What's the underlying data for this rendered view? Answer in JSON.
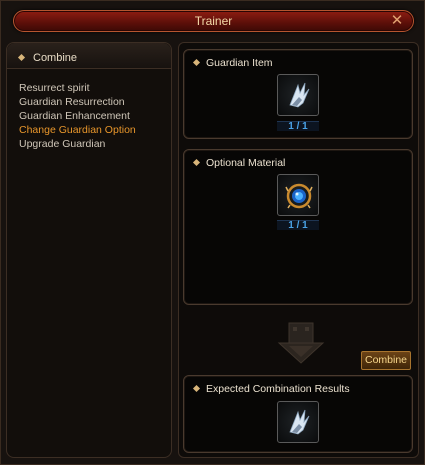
{
  "window": {
    "title": "Trainer",
    "close_glyph": "✕"
  },
  "left_panel": {
    "header": "Combine",
    "items": [
      {
        "label": "Resurrect spirit",
        "active": false
      },
      {
        "label": "Guardian Resurrection",
        "active": false
      },
      {
        "label": "Guardian Enhancement",
        "active": false
      },
      {
        "label": "Change Guardian Option",
        "active": true
      },
      {
        "label": "Upgrade Guardian",
        "active": false
      }
    ]
  },
  "guardian_item": {
    "label": "Guardian Item",
    "count": "1 / 1",
    "icon": "guardian-wing-icon"
  },
  "optional_material": {
    "label": "Optional Material",
    "count": "1 / 1",
    "icon": "blue-orb-icon"
  },
  "combine_button": {
    "label": "Combine"
  },
  "expected_results": {
    "label": "Expected Combination Results",
    "icon": "guardian-wing-icon"
  },
  "colors": {
    "accent_orange": "#e8962b",
    "count_blue": "#4aa3e8",
    "title_red": "#8e1d12"
  }
}
